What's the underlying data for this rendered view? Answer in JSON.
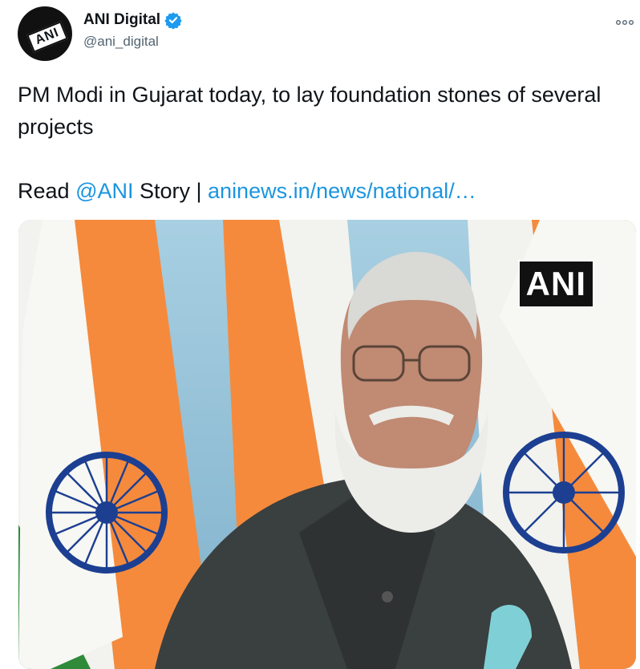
{
  "account": {
    "display_name": "ANI Digital",
    "handle": "@ani_digital",
    "avatar_text": "ANI"
  },
  "tweet": {
    "line1": "PM Modi in Gujarat today, to lay foundation stones of several projects",
    "read_prefix": "Read ",
    "mention": "@ANI",
    "story_sep": " Story | ",
    "link_text": "aninews.in/news/national/…"
  },
  "media": {
    "watermark": "ANI"
  },
  "colors": {
    "link": "#1b95e0",
    "verified": "#1d9bf0",
    "saffron": "#f58a3c",
    "green": "#2f8a3a",
    "chakra": "#1c3f91"
  },
  "icons": {
    "verified": "verified-badge-icon",
    "more": "more-options-icon"
  }
}
